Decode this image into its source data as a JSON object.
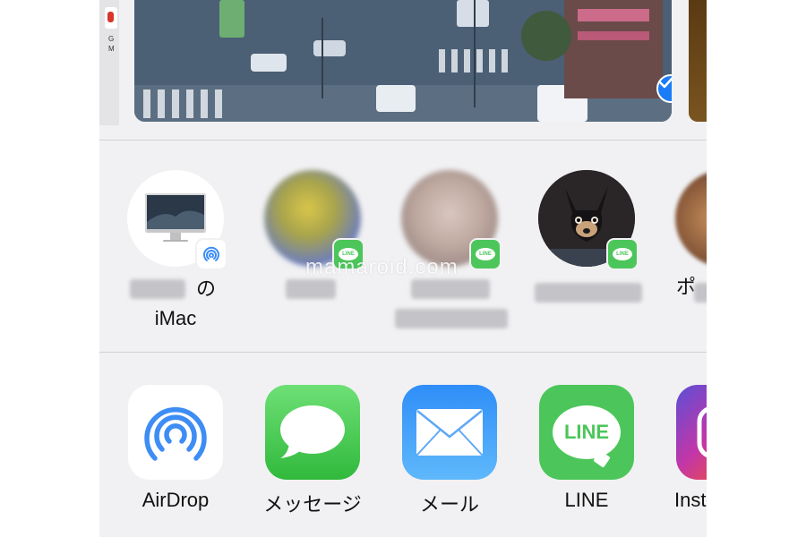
{
  "watermark": "mamaroid.com",
  "photo_strip": {
    "left_fragment_text": "G\nM",
    "selected_check": "✓"
  },
  "people": [
    {
      "name_line1": "の",
      "name_line2": "iMac",
      "badge": "airdrop-badge-icon"
    },
    {
      "name_line1": "",
      "name_line2": "",
      "badge": "line-badge-icon",
      "badge_text": "LINE"
    },
    {
      "name_line1": "",
      "name_line2": "",
      "badge": "line-badge-icon",
      "badge_text": "LINE"
    },
    {
      "name_line1": "",
      "name_line2": "",
      "badge": "line-badge-icon",
      "badge_text": "LINE"
    },
    {
      "name_line1": "ポ",
      "name_line2": "",
      "badge": ""
    }
  ],
  "apps": [
    {
      "label": "AirDrop",
      "icon": "airdrop-icon"
    },
    {
      "label": "メッセージ",
      "icon": "messages-icon"
    },
    {
      "label": "メール",
      "icon": "mail-icon"
    },
    {
      "label": "LINE",
      "icon": "line-icon",
      "icon_text": "LINE"
    },
    {
      "label": "Inst",
      "icon": "instagram-icon"
    }
  ],
  "colors": {
    "sheet_bg": "#f1f1f3",
    "check_blue": "#1a7cf6",
    "line_green": "#4cc65a",
    "airdrop_blue": "#3d8df5"
  }
}
